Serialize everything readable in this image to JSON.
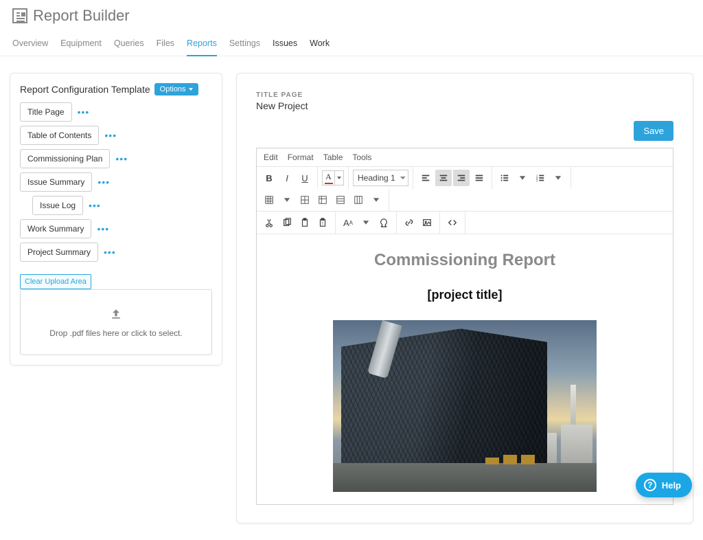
{
  "header": {
    "title": "Report Builder"
  },
  "tabs": {
    "items": [
      "Overview",
      "Equipment",
      "Queries",
      "Files",
      "Reports",
      "Settings",
      "Issues",
      "Work"
    ],
    "active_index": 4
  },
  "sidebar": {
    "title": "Report Configuration Template",
    "options_label": "Options",
    "sections": [
      {
        "label": "Title Page",
        "indent": false,
        "dots": true
      },
      {
        "label": "Table of Contents",
        "indent": false,
        "dots": true
      },
      {
        "label": "Commissioning Plan",
        "indent": false,
        "dots": true
      },
      {
        "label": "Issue Summary",
        "indent": false,
        "dots": true
      },
      {
        "label": "Issue Log",
        "indent": true,
        "dots": true
      },
      {
        "label": "Work Summary",
        "indent": false,
        "dots": true
      },
      {
        "label": "Project Summary",
        "indent": false,
        "dots": true
      }
    ],
    "clear_upload_label": "Clear Upload Area",
    "dropzone_text": "Drop .pdf files here or click to select."
  },
  "main": {
    "section_label": "TITLE PAGE",
    "project_name": "New Project",
    "save_label": "Save"
  },
  "editor": {
    "menu": [
      "Edit",
      "Format",
      "Table",
      "Tools"
    ],
    "heading_select": "Heading 1",
    "document": {
      "title": "Commissioning Report",
      "subtitle": "[project title]"
    }
  },
  "help": {
    "label": "Help"
  }
}
